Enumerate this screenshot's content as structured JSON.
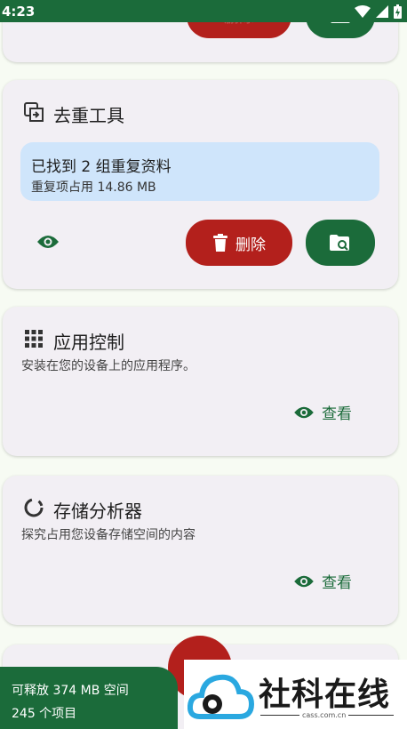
{
  "status_bar": {
    "time": "4:23"
  },
  "top_card": {
    "delete_label": "删除"
  },
  "dedupe": {
    "title": "去重工具",
    "found_text": "已找到 2 组重复资料",
    "size_text": "重复项占用 14.86 MB",
    "delete_label": "删除"
  },
  "app_control": {
    "title": "应用控制",
    "description": "安装在您的设备上的应用程序。",
    "view_label": "查看"
  },
  "storage": {
    "title": "存储分析器",
    "description": "探究占用您设备存储空间的内容",
    "view_label": "查看"
  },
  "bottom_summary": {
    "freeable": "可释放 374 MB 空间",
    "items": "245 个项目"
  },
  "watermark": {
    "name": "社科在线",
    "domain": "cass.com.cn"
  },
  "colors": {
    "primary": "#1b6b3a",
    "danger": "#b3201c",
    "info": "#cfe5fb",
    "card": "#f2eff4"
  }
}
